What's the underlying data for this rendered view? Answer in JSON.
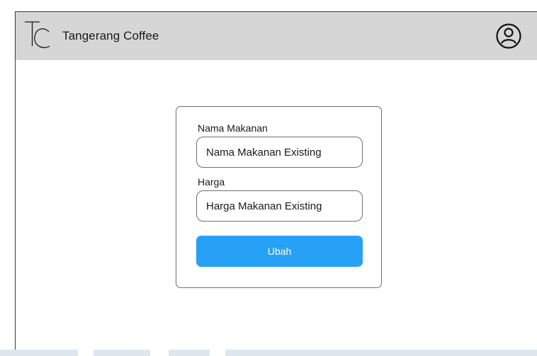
{
  "header": {
    "brand_name": "Tangerang Coffee",
    "logo_icon": "tc-monogram-logo",
    "profile_icon": "user-circle-icon"
  },
  "form": {
    "food_name_label": "Nama Makanan",
    "food_name_value": "Nama Makanan Existing",
    "price_label": "Harga",
    "price_value": "Harga Makanan Existing",
    "submit_label": "Ubah"
  },
  "colors": {
    "topbar": "#d6d6d6",
    "primary_button": "#27a1f5",
    "button_text": "#ffffff"
  }
}
